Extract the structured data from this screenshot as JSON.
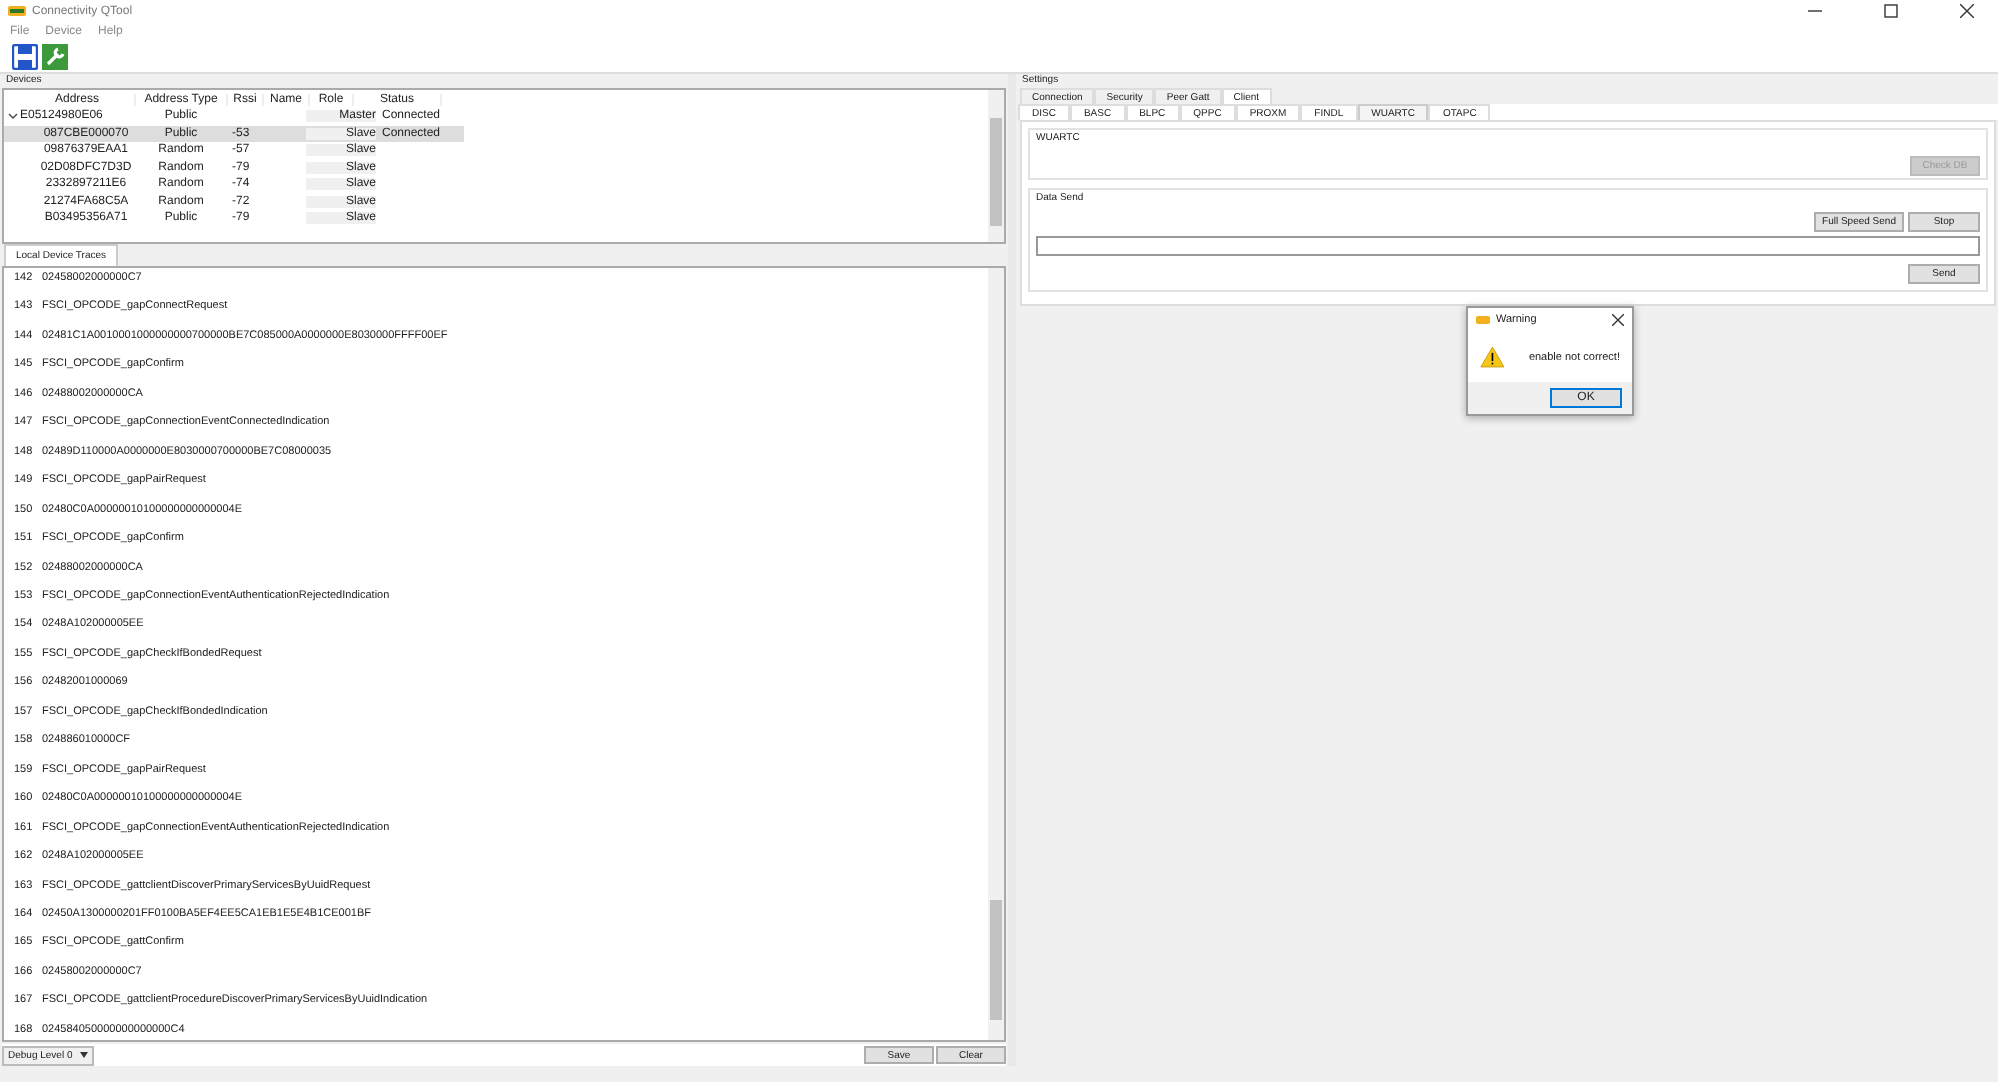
{
  "window": {
    "title": "Connectivity QTool"
  },
  "menu": [
    "File",
    "Device",
    "Help"
  ],
  "devices": {
    "label": "Devices",
    "columns": [
      "Address",
      "Address Type",
      "Rssi",
      "Name",
      "Role",
      "Status"
    ],
    "rows": [
      {
        "address": "E05124980E06",
        "address_type": "Public",
        "role": "Master",
        "status": "Connected",
        "expanded": true,
        "selected": false,
        "children": [
          {
            "address": "087CBE000070",
            "address_type": "Public",
            "rssi": "-53",
            "role": "Slave",
            "status": "Connected",
            "selected": true
          },
          {
            "address": "09876379EAA1",
            "address_type": "Random",
            "rssi": "-57",
            "role": "Slave",
            "selected": false
          },
          {
            "address": "02D08DFC7D3D",
            "address_type": "Random",
            "rssi": "-79",
            "role": "Slave",
            "selected": false
          },
          {
            "address": "2332897211E6",
            "address_type": "Random",
            "rssi": "-74",
            "role": "Slave",
            "selected": false
          },
          {
            "address": "21274FA68C5A",
            "address_type": "Random",
            "rssi": "-72",
            "role": "Slave",
            "selected": false
          },
          {
            "address": "B03495356A71",
            "address_type": "Public",
            "rssi": "-79",
            "role": "Slave",
            "selected": false
          }
        ]
      }
    ]
  },
  "traces": {
    "tab": "Local Device Traces",
    "lines": [
      {
        "number": "142",
        "text": "02458002000000C7"
      },
      {
        "number": "143",
        "text": "FSCI_OPCODE_gapConnectRequest"
      },
      {
        "number": "144",
        "text": "02481C1A0010001000000000700000BE7C085000A0000000E8030000FFFF00EF"
      },
      {
        "number": "145",
        "text": "FSCI_OPCODE_gapConfirm"
      },
      {
        "number": "146",
        "text": "02488002000000CA"
      },
      {
        "number": "147",
        "text": "FSCI_OPCODE_gapConnectionEventConnectedIndication"
      },
      {
        "number": "148",
        "text": "02489D110000A0000000E8030000700000BE7C08000035"
      },
      {
        "number": "149",
        "text": "FSCI_OPCODE_gapPairRequest"
      },
      {
        "number": "150",
        "text": "02480C0A00000010100000000000004E"
      },
      {
        "number": "151",
        "text": "FSCI_OPCODE_gapConfirm"
      },
      {
        "number": "152",
        "text": "02488002000000CA"
      },
      {
        "number": "153",
        "text": "FSCI_OPCODE_gapConnectionEventAuthenticationRejectedIndication"
      },
      {
        "number": "154",
        "text": "0248A102000005EE"
      },
      {
        "number": "155",
        "text": "FSCI_OPCODE_gapCheckIfBondedRequest"
      },
      {
        "number": "156",
        "text": "02482001000069"
      },
      {
        "number": "157",
        "text": "FSCI_OPCODE_gapCheckIfBondedIndication"
      },
      {
        "number": "158",
        "text": "024886010000CF"
      },
      {
        "number": "159",
        "text": "FSCI_OPCODE_gapPairRequest"
      },
      {
        "number": "160",
        "text": "02480C0A00000010100000000000004E"
      },
      {
        "number": "161",
        "text": "FSCI_OPCODE_gapConnectionEventAuthenticationRejectedIndication"
      },
      {
        "number": "162",
        "text": "0248A102000005EE"
      },
      {
        "number": "163",
        "text": "FSCI_OPCODE_gattclientDiscoverPrimaryServicesByUuidRequest"
      },
      {
        "number": "164",
        "text": "02450A1300000201FF0100BA5EF4EE5CA1EB1E5E4B1CE001BF"
      },
      {
        "number": "165",
        "text": "FSCI_OPCODE_gattConfirm"
      },
      {
        "number": "166",
        "text": "02458002000000C7"
      },
      {
        "number": "167",
        "text": "FSCI_OPCODE_gattclientProcedureDiscoverPrimaryServicesByUuidIndication"
      },
      {
        "number": "168",
        "text": "024584050000000000000C4"
      }
    ],
    "debug_level": "Debug Level 0",
    "buttons": [
      "Save",
      "Clear"
    ]
  },
  "settings": {
    "label": "Settings",
    "tabs": [
      {
        "label": "Connection",
        "selected": false
      },
      {
        "label": "Security",
        "selected": false
      },
      {
        "label": "Peer Gatt",
        "selected": false
      },
      {
        "label": "Client",
        "selected": true
      }
    ],
    "subtabs": [
      {
        "label": "DISC",
        "selected": false
      },
      {
        "label": "BASC",
        "selected": false
      },
      {
        "label": "BLPC",
        "selected": false
      },
      {
        "label": "QPPC",
        "selected": false
      },
      {
        "label": "PROXM",
        "selected": false
      },
      {
        "label": "FINDL",
        "selected": false
      },
      {
        "label": "WUARTC",
        "selected": true
      },
      {
        "label": "OTAPC",
        "selected": false
      }
    ],
    "wuartc_group": {
      "title": "WUARTC",
      "button": {
        "label": "Check DB",
        "disabled": true
      }
    },
    "data_send_group": {
      "title": "Data Send",
      "buttons": [
        {
          "label": "Full Speed Send",
          "disabled": false
        },
        {
          "label": "Stop",
          "disabled": false
        }
      ],
      "send_button": {
        "label": "Send",
        "disabled": false
      }
    }
  },
  "dialog": {
    "title": "Warning",
    "message": "enable not correct!",
    "button": "OK"
  }
}
